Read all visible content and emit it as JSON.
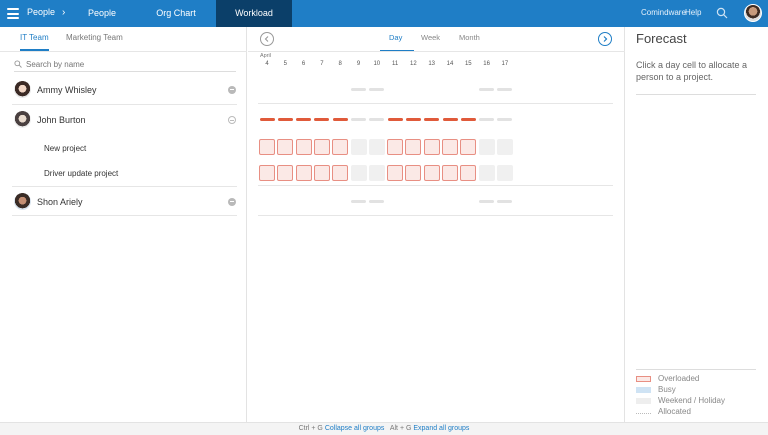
{
  "topbar": {
    "breadcrumb": "People",
    "breadcrumb_chevron": "›",
    "tabs": [
      {
        "label": "People"
      },
      {
        "label": "Org Chart"
      },
      {
        "label": "Workload",
        "active": true
      }
    ],
    "brand": "Comindware",
    "help": "Help",
    "color": "#1f7ec6",
    "active_tab_color": "#0b3f69"
  },
  "teams": {
    "tabs": [
      {
        "label": "IT Team",
        "active": true
      },
      {
        "label": "Marketing Team"
      }
    ],
    "search_placeholder": "Search by name",
    "people": [
      {
        "name": "Ammy Whisley",
        "expanded": false
      },
      {
        "name": "John Burton",
        "expanded": true,
        "projects": [
          "New project",
          "Driver update project"
        ]
      },
      {
        "name": "Shon Ariely",
        "expanded": false
      }
    ]
  },
  "calendar": {
    "scales": [
      {
        "label": "Day",
        "active": true
      },
      {
        "label": "Week"
      },
      {
        "label": "Month"
      }
    ],
    "month": "April",
    "days": [
      "4",
      "5",
      "6",
      "7",
      "8",
      "9",
      "10",
      "11",
      "12",
      "13",
      "14",
      "15",
      "16",
      "17"
    ],
    "weekend_indices": [
      5,
      6,
      12,
      13
    ],
    "overloaded_color": "#e05a3a"
  },
  "forecast": {
    "title": "Forecast",
    "hint": "Click a day cell to allocate a person to a project.",
    "legend": [
      {
        "key": "over",
        "label": "Overloaded"
      },
      {
        "key": "busy",
        "label": "Busy"
      },
      {
        "key": "weekend",
        "label": "Weekend / Holiday"
      },
      {
        "key": "alloc",
        "label": "Allocated"
      }
    ]
  },
  "footer": {
    "collapse_shortcut": "Ctrl + G",
    "collapse_label": "Collapse all groups",
    "expand_shortcut": "Alt + G",
    "expand_label": "Expand all groups"
  }
}
